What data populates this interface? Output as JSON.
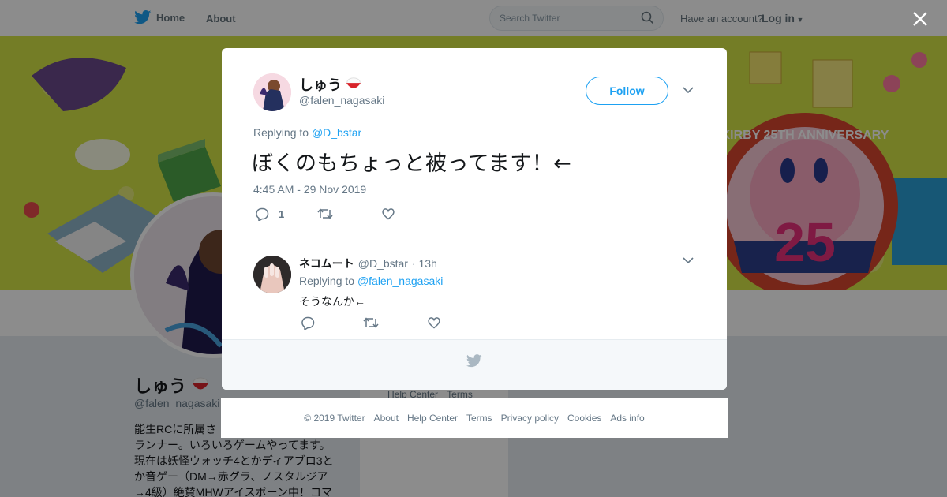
{
  "nav": {
    "home_label": "Home",
    "about_label": "About",
    "search_placeholder": "Search Twitter",
    "account_prompt": "Have an account?",
    "login_label": "Log in"
  },
  "profile": {
    "name": "しゅう",
    "handle": "@falen_nagasaki",
    "bio_lines": [
      "能生RCに所属さ",
      "ランナー。いろいろゲームやってます。",
      "現在は妖怪ウォッチ4とかディアブロ3と",
      "か音ゲー（DM→赤グラ、ノスタルジア",
      "→4級）絶賛MHWアイスボーン中！コマ"
    ]
  },
  "side_links": {
    "help_center": "Help Center",
    "terms": "Terms"
  },
  "banner_text": "KIRBY 25TH ANNIVERSARY",
  "banner_number": "25",
  "tweet": {
    "author_name": "しゅう",
    "author_handle": "@falen_nagasaki",
    "follow_label": "Follow",
    "replying_prefix": "Replying to",
    "replying_to": "@D_bstar",
    "text": "ぼくのもちょっと被ってます！←",
    "timestamp": "4:45 AM - 29 Nov 2019",
    "reply_count": "1"
  },
  "reply": {
    "author_name": "ネコムート",
    "author_handle": "@D_bstar",
    "age": "· 13h",
    "replying_prefix": "Replying to",
    "replying_to": "@falen_nagasaki",
    "text": "そうなんか←"
  },
  "footer": {
    "copyright": "© 2019 Twitter",
    "about": "About",
    "help_center": "Help Center",
    "terms": "Terms",
    "privacy": "Privacy policy",
    "cookies": "Cookies",
    "ads_info": "Ads info"
  },
  "colors": {
    "accent": "#1da1f2",
    "secondary_text": "#657786",
    "primary_text": "#14171a"
  }
}
